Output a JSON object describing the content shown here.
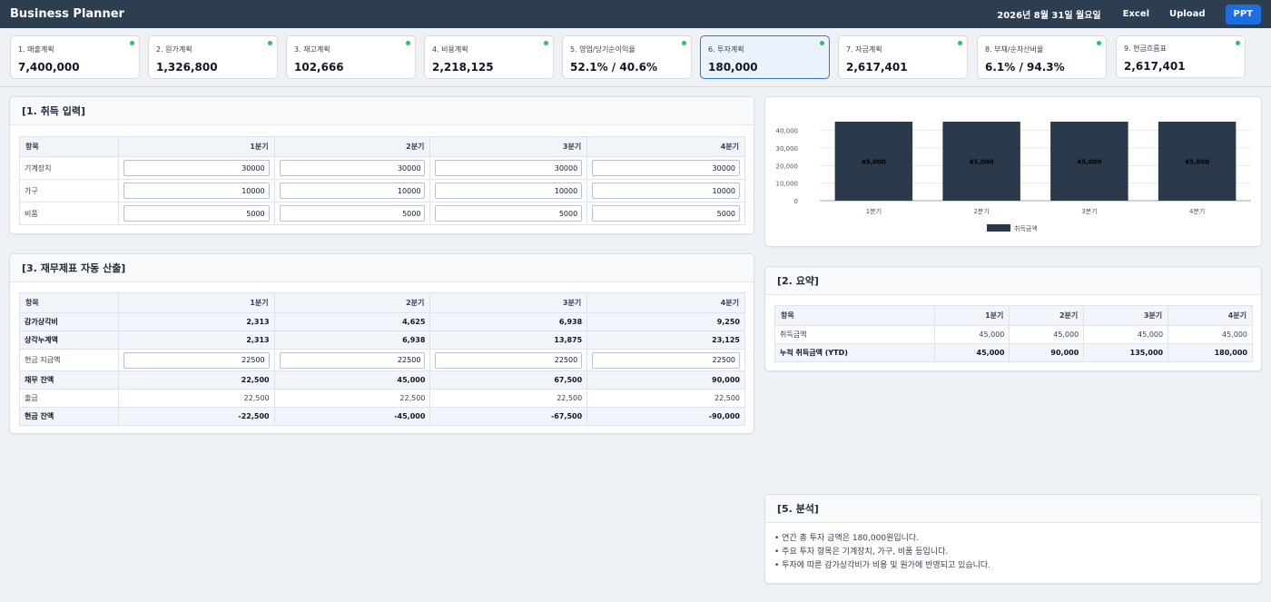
{
  "header": {
    "title": "Business Planner",
    "date": "2026년 8월 31일 월요일",
    "excel": "Excel",
    "upload": "Upload",
    "ppt": "PPT"
  },
  "kpis": [
    {
      "label": "1. 매출계획",
      "value": "7,400,000",
      "dot": true
    },
    {
      "label": "2. 원가계획",
      "value": "1,326,800",
      "dot": true
    },
    {
      "label": "3. 재고계획",
      "value": "102,666",
      "dot": true
    },
    {
      "label": "4. 비용계획",
      "value": "2,218,125",
      "dot": true
    },
    {
      "label": "5. 영업/당기순이익율",
      "value": "52.1% / 40.6%",
      "dot": true
    },
    {
      "label": "6. 투자계획",
      "value": "180,000",
      "dot": true,
      "active": true
    },
    {
      "label": "7. 자금계획",
      "value": "2,617,401",
      "dot": true
    },
    {
      "label": "8. 부채/순자산비율",
      "value": "6.1% / 94.3%",
      "dot": true
    },
    {
      "label": "9. 현금흐름표",
      "value": "2,617,401",
      "dot": true
    }
  ],
  "acquisition": {
    "title": "[1. 취득 입력]",
    "headers": [
      "항목",
      "1분기",
      "2분기",
      "3분기",
      "4분기"
    ],
    "rows": [
      {
        "label": "기계장치",
        "values": [
          "30000",
          "30000",
          "30000",
          "30000"
        ]
      },
      {
        "label": "가구",
        "values": [
          "10000",
          "10000",
          "10000",
          "10000"
        ]
      },
      {
        "label": "비품",
        "values": [
          "5000",
          "5000",
          "5000",
          "5000"
        ]
      }
    ]
  },
  "financial": {
    "title": "[3. 재무제표 자동 산출]",
    "headers": [
      "항목",
      "1분기",
      "2분기",
      "3분기",
      "4분기"
    ],
    "rows": [
      {
        "label": "감가상각비",
        "values": [
          "2,313",
          "4,625",
          "6,938",
          "9,250"
        ]
      },
      {
        "label": "상각누계액",
        "values": [
          "2,313",
          "6,938",
          "13,875",
          "23,125"
        ]
      },
      {
        "label": "현금 지급액",
        "values": [
          "22500",
          "22500",
          "22500",
          "22500"
        ]
      },
      {
        "label": "채무 잔액",
        "values": [
          "22,500",
          "45,000",
          "67,500",
          "90,000"
        ]
      },
      {
        "label": "출금",
        "values": [
          "22,500",
          "22,500",
          "22,500",
          "22,500"
        ]
      },
      {
        "label": "현금 잔액",
        "values": [
          "-22,500",
          "-45,000",
          "-67,500",
          "-90,000"
        ]
      }
    ]
  },
  "summary": {
    "title": "[2. 요약]",
    "headers": [
      "항목",
      "1분기",
      "2분기",
      "3분기",
      "4분기"
    ],
    "rows": [
      {
        "label": "취득금액",
        "values": [
          "45,000",
          "45,000",
          "45,000",
          "45,000"
        ]
      },
      {
        "label": "누적 취득금액 (YTD)",
        "values": [
          "45,000",
          "90,000",
          "135,000",
          "180,000"
        ]
      }
    ]
  },
  "analysis": {
    "title": "[5. 분석]",
    "lines": [
      "• 연간 총 투자 금액은 180,000원입니다.",
      "• 주요 투자 항목은 기계장치, 가구, 비품 등입니다.",
      "• 투자에 따른 감가상각비가 비용 및 원가에 반영되고 있습니다."
    ]
  },
  "chart_data": {
    "type": "bar",
    "categories": [
      "1분기",
      "2분기",
      "3분기",
      "4분기"
    ],
    "series": [
      {
        "name": "취득금액",
        "values": [
          45000,
          45000,
          45000,
          45000
        ]
      }
    ],
    "data_labels": [
      "45,000",
      "45,000",
      "45,000",
      "45,000"
    ],
    "yticks": [
      "0",
      "10,000",
      "20,000",
      "30,000",
      "40,000"
    ],
    "ylim": [
      0,
      45000
    ],
    "legend_position": "bottom",
    "color": "#2b3a4a"
  }
}
